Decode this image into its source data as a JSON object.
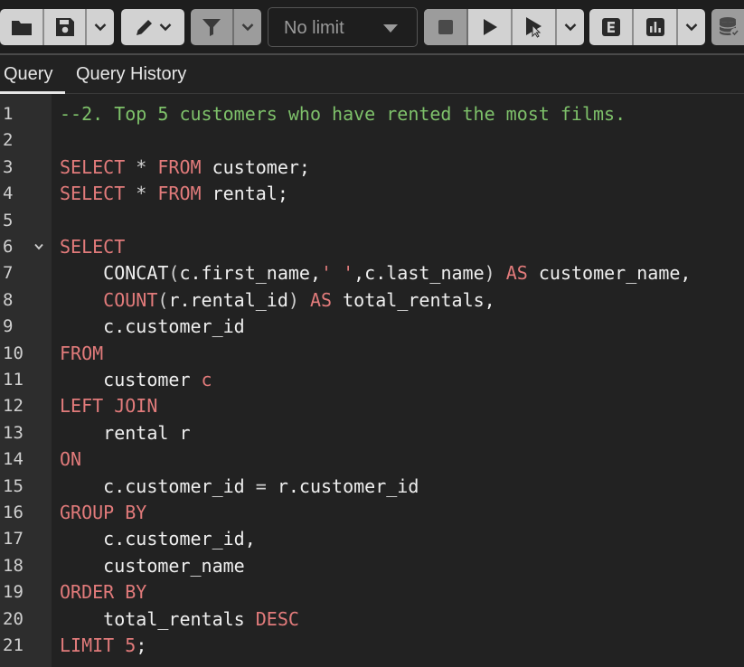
{
  "toolbar": {
    "groups": [
      {
        "name": "file",
        "buttons": [
          "folder-icon",
          "save-icon",
          "chevron-down-icon"
        ]
      },
      {
        "name": "edit",
        "buttons": [
          "pen-icon",
          "chevron-down-icon"
        ]
      },
      {
        "name": "filter",
        "buttons": [
          "filter-icon",
          "chevron-down-icon"
        ]
      },
      {
        "name": "execute",
        "buttons": [
          "stop-icon",
          "play-icon",
          "play-cursor-icon",
          "chevron-down-icon"
        ]
      },
      {
        "name": "explain",
        "buttons": [
          "explain-icon",
          "bar-chart-icon",
          "chevron-down-icon"
        ]
      },
      {
        "name": "commit",
        "buttons": [
          "database-icon"
        ]
      }
    ],
    "limit_select": {
      "value": "No limit"
    }
  },
  "tabs": [
    {
      "label": "Query",
      "active": true
    },
    {
      "label": "Query History",
      "active": false
    }
  ],
  "editor": {
    "folded_line": 6,
    "lines": [
      {
        "n": "1",
        "tokens": [
          {
            "t": "--2. Top 5 customers who have rented the most films.",
            "c": "cm"
          }
        ]
      },
      {
        "n": "2",
        "tokens": []
      },
      {
        "n": "3",
        "tokens": [
          {
            "t": "SELECT",
            "c": "kw"
          },
          {
            "t": " * ",
            "c": "op"
          },
          {
            "t": "FROM",
            "c": "kw"
          },
          {
            "t": " customer;",
            "c": ""
          }
        ]
      },
      {
        "n": "4",
        "tokens": [
          {
            "t": "SELECT",
            "c": "kw"
          },
          {
            "t": " * ",
            "c": "op"
          },
          {
            "t": "FROM",
            "c": "kw"
          },
          {
            "t": " rental;",
            "c": ""
          }
        ]
      },
      {
        "n": "5",
        "tokens": []
      },
      {
        "n": "6",
        "tokens": [
          {
            "t": "SELECT",
            "c": "kw"
          }
        ]
      },
      {
        "n": "7",
        "tokens": [
          {
            "t": "    CONCAT",
            "c": ""
          },
          {
            "t": "(",
            "c": "op"
          },
          {
            "t": "c.first_name,",
            "c": ""
          },
          {
            "t": "' '",
            "c": "st"
          },
          {
            "t": ",c.last_name",
            "c": ""
          },
          {
            "t": ")",
            "c": "op"
          },
          {
            "t": " ",
            "c": ""
          },
          {
            "t": "AS",
            "c": "kw"
          },
          {
            "t": " customer_name,",
            "c": ""
          }
        ]
      },
      {
        "n": "8",
        "tokens": [
          {
            "t": "    ",
            "c": ""
          },
          {
            "t": "COUNT",
            "c": "kw"
          },
          {
            "t": "(",
            "c": "op"
          },
          {
            "t": "r.rental_id",
            "c": ""
          },
          {
            "t": ")",
            "c": "op"
          },
          {
            "t": " ",
            "c": ""
          },
          {
            "t": "AS",
            "c": "kw"
          },
          {
            "t": " total_rentals,",
            "c": ""
          }
        ]
      },
      {
        "n": "9",
        "tokens": [
          {
            "t": "    c.customer_id",
            "c": ""
          }
        ]
      },
      {
        "n": "10",
        "tokens": [
          {
            "t": "FROM",
            "c": "kw"
          }
        ]
      },
      {
        "n": "11",
        "tokens": [
          {
            "t": "    customer ",
            "c": ""
          },
          {
            "t": "c",
            "c": "kw"
          }
        ]
      },
      {
        "n": "12",
        "tokens": [
          {
            "t": "LEFT JOIN",
            "c": "kw"
          }
        ]
      },
      {
        "n": "13",
        "tokens": [
          {
            "t": "    rental r",
            "c": ""
          }
        ]
      },
      {
        "n": "14",
        "tokens": [
          {
            "t": "ON",
            "c": "kw"
          }
        ]
      },
      {
        "n": "15",
        "tokens": [
          {
            "t": "    c.customer_id ",
            "c": ""
          },
          {
            "t": "=",
            "c": "op"
          },
          {
            "t": " r.customer_id",
            "c": ""
          }
        ]
      },
      {
        "n": "16",
        "tokens": [
          {
            "t": "GROUP BY",
            "c": "kw"
          }
        ]
      },
      {
        "n": "17",
        "tokens": [
          {
            "t": "    c.customer_id,",
            "c": ""
          }
        ]
      },
      {
        "n": "18",
        "tokens": [
          {
            "t": "    customer_name",
            "c": ""
          }
        ]
      },
      {
        "n": "19",
        "tokens": [
          {
            "t": "ORDER BY",
            "c": "kw"
          }
        ]
      },
      {
        "n": "20",
        "tokens": [
          {
            "t": "    total_rentals ",
            "c": ""
          },
          {
            "t": "DESC",
            "c": "kw"
          }
        ]
      },
      {
        "n": "21",
        "tokens": [
          {
            "t": "LIMIT",
            "c": "kw"
          },
          {
            "t": " ",
            "c": ""
          },
          {
            "t": "5",
            "c": "nm"
          },
          {
            "t": ";",
            "c": ""
          }
        ]
      }
    ]
  },
  "colors": {
    "keyword": "#e27b7b",
    "comment": "#7ec16a",
    "text": "#efefef",
    "gutter_bg": "#2d2d2d",
    "editor_bg": "#222222",
    "toolbar_button": "#d2d2d2"
  }
}
